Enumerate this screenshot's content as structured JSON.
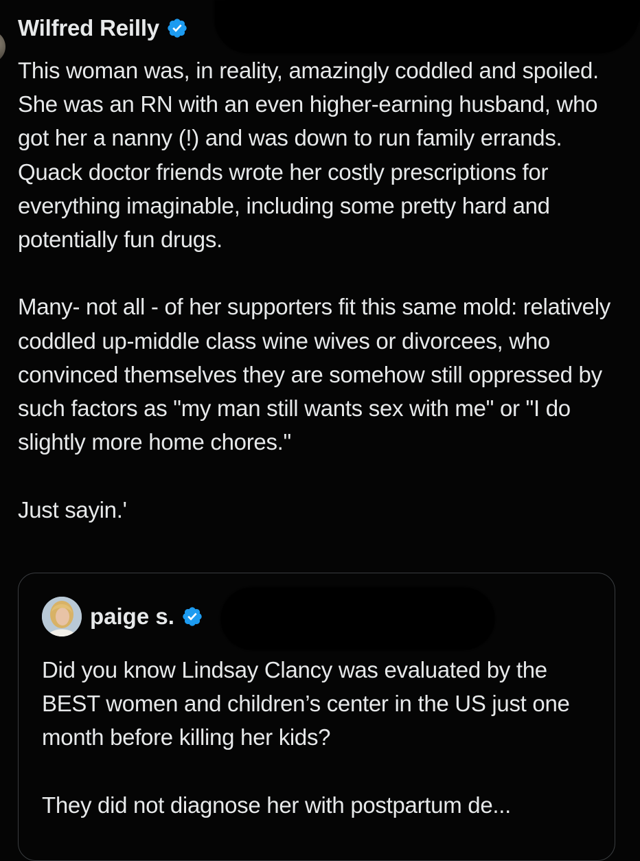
{
  "tweet": {
    "author_name": "Wilfred Reilly",
    "verified_icon": "verified-badge-icon",
    "paragraphs": [
      "This woman was, in reality, amazingly coddled and spoiled. She was an RN with an even higher-earning husband, who got her a nanny (!) and was down to run family errands. Quack doctor friends wrote her costly prescriptions for everything imaginable, including some pretty hard and potentially fun drugs.",
      "Many- not all - of her supporters fit this same mold: relatively coddled up-middle class wine wives or divorcees, who convinced themselves they are somehow still oppressed by such factors as \"my man still wants sex with me\" or \"I do slightly more home chores.\"",
      "Just sayin.'"
    ]
  },
  "quoted_tweet": {
    "author_name": "paige s.",
    "verified_icon": "verified-badge-icon",
    "paragraphs": [
      "Did you know Lindsay Clancy was evaluated by the BEST women and children’s center in the US just one month before killing her kids?",
      "They did not diagnose her with postpartum de..."
    ]
  },
  "colors": {
    "background": "#050505",
    "text": "#e7e9ea",
    "verified": "#1d9bf0",
    "card_border": "#3a3d40"
  }
}
